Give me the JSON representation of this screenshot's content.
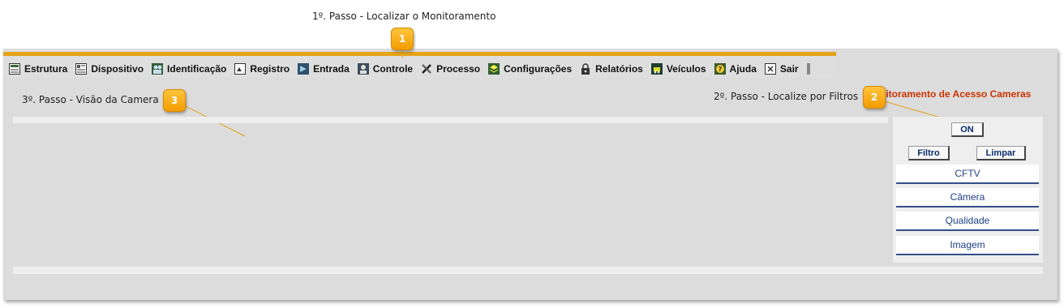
{
  "annotations": {
    "step1": "1º. Passo - Localizar o Monitoramento",
    "step2": "2º. Passo - Localize por Filtros",
    "step3": "3º. Passo - Visão da Camera",
    "badge1": "1",
    "badge2": "2",
    "badge3": "3"
  },
  "menu": {
    "items": [
      {
        "label": "Estrutura",
        "icon": "grid-icon"
      },
      {
        "label": "Dispositivo",
        "icon": "device-icon"
      },
      {
        "label": "Identificação",
        "icon": "people-icon"
      },
      {
        "label": "Registro",
        "icon": "register-icon"
      },
      {
        "label": "Entrada",
        "icon": "entry-icon"
      },
      {
        "label": "Controle",
        "icon": "control-icon"
      },
      {
        "label": "Processo",
        "icon": "tools-icon"
      },
      {
        "label": "Configurações",
        "icon": "layers-icon"
      },
      {
        "label": "Relatórios",
        "icon": "lock-icon"
      },
      {
        "label": "Veículos",
        "icon": "vehicle-icon"
      },
      {
        "label": "Ajuda",
        "icon": "help-icon"
      },
      {
        "label": "Sair",
        "icon": "exit-icon"
      }
    ]
  },
  "page_title": "nitoramento de Acesso Cameras",
  "filters": {
    "on_label": "ON",
    "filtro_label": "Filtro",
    "limpar_label": "Limpar",
    "rows": [
      "CFTV",
      "Câmera",
      "Qualidade",
      "Imagem"
    ]
  },
  "colors": {
    "accent": "#e5a317",
    "title": "#cc3300",
    "link": "#1f3f86"
  }
}
